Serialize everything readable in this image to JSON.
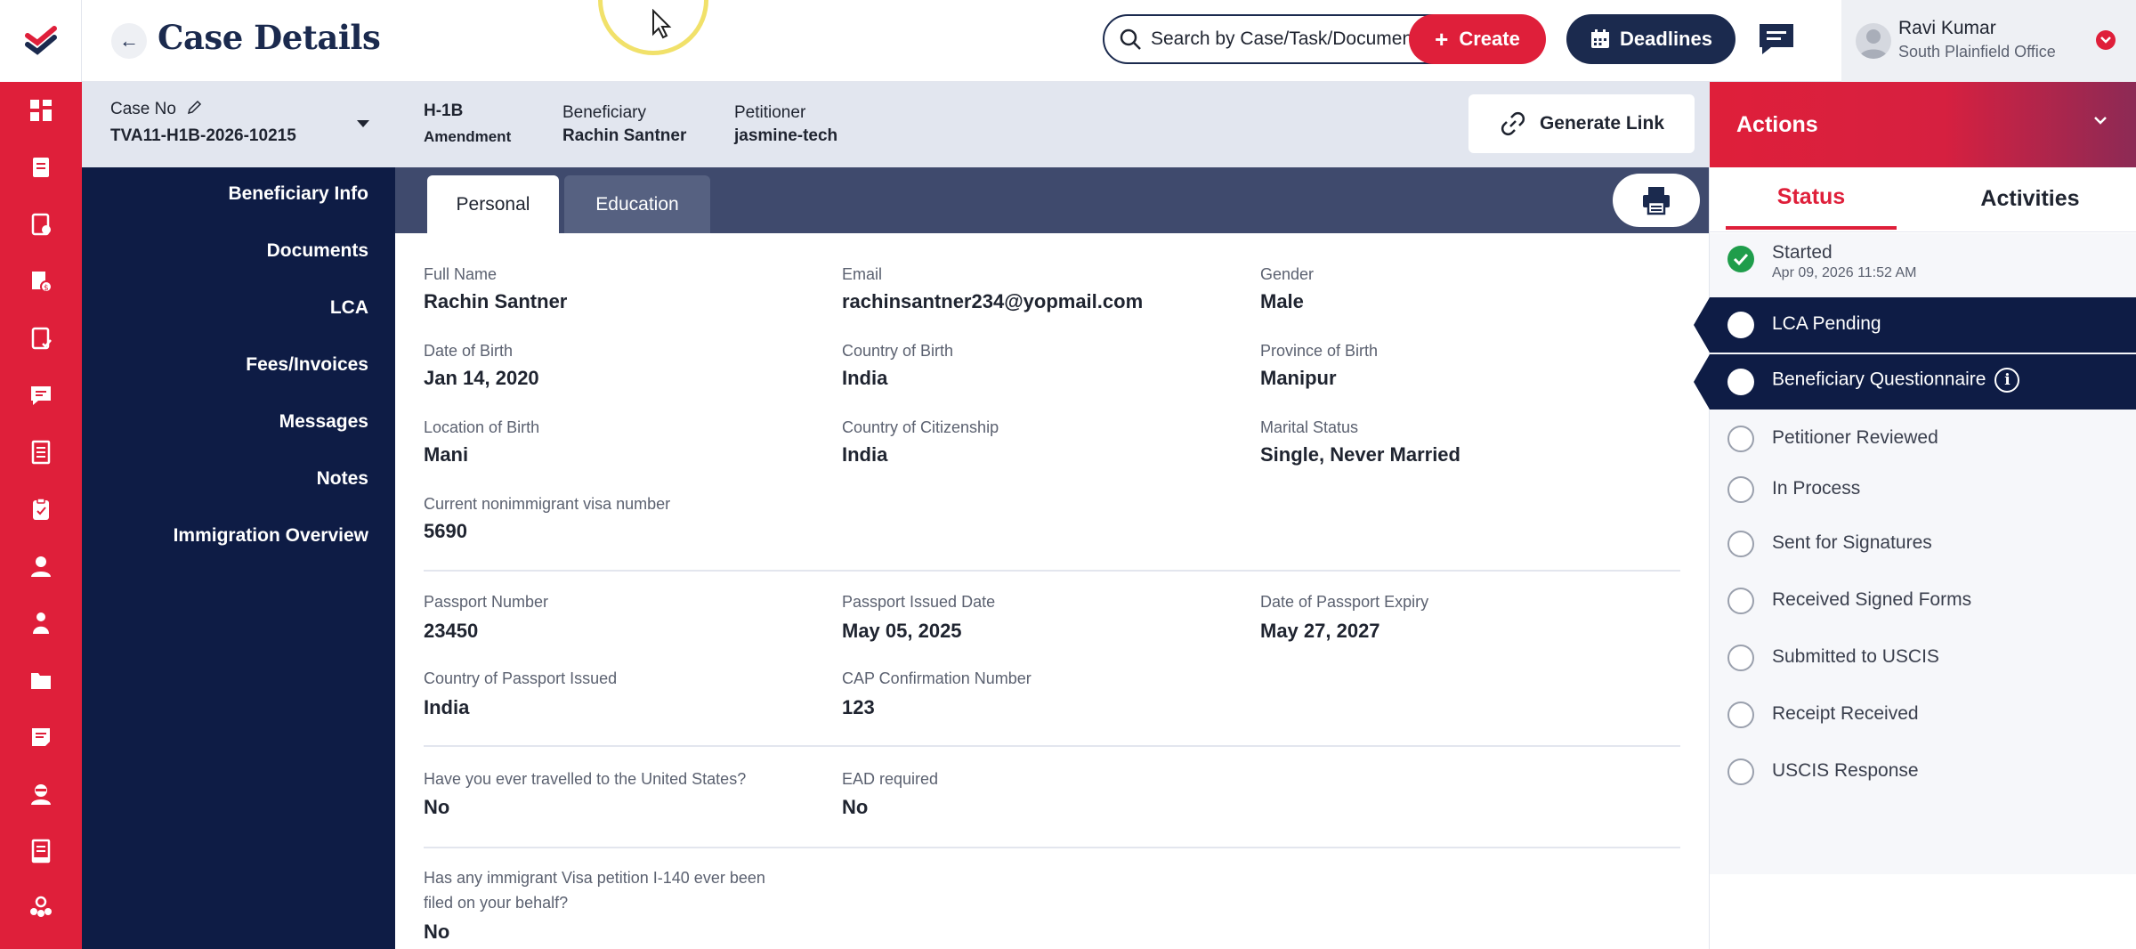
{
  "header": {
    "title": "Case Details",
    "search_placeholder": "Search by Case/Task/Document",
    "create_label": "Create",
    "deadlines_label": "Deadlines",
    "user_name": "Ravi Kumar",
    "user_office": "South Plainfield Office"
  },
  "case": {
    "case_no_label": "Case No",
    "case_no": "TVA11-H1B-2026-10215",
    "visa_type": "H-1B",
    "visa_subtype": "Amendment",
    "beneficiary_label": "Beneficiary",
    "beneficiary": "Rachin Santner",
    "petitioner_label": "Petitioner",
    "petitioner": "jasmine-tech",
    "generate_link_label": "Generate Link"
  },
  "nav": {
    "items": [
      "Beneficiary Info",
      "Documents",
      "LCA",
      "Fees/Invoices",
      "Messages",
      "Notes",
      "Immigration Overview"
    ]
  },
  "tabs": {
    "personal": "Personal",
    "education": "Education"
  },
  "personal": {
    "full_name_label": "Full Name",
    "full_name": "Rachin Santner",
    "email_label": "Email",
    "email": "rachinsantner234@yopmail.com",
    "gender_label": "Gender",
    "gender": "Male",
    "dob_label": "Date of Birth",
    "dob": "Jan 14, 2020",
    "cob_label": "Country of Birth",
    "cob": "India",
    "pob_label": "Province of Birth",
    "pob": "Manipur",
    "lob_label": "Location of Birth",
    "lob": "Mani",
    "citizenship_label": "Country of Citizenship",
    "citizenship": "India",
    "marital_label": "Marital Status",
    "marital": "Single, Never Married",
    "visa_no_label": "Current nonimmigrant visa number",
    "visa_no": "5690",
    "passport_no_label": "Passport Number",
    "passport_no": "23450",
    "passport_issued_label": "Passport Issued Date",
    "passport_issued": "May 05, 2025",
    "passport_expiry_label": "Date of Passport Expiry",
    "passport_expiry": "May 27, 2027",
    "passport_country_label": "Country of Passport Issued",
    "passport_country": "India",
    "cap_label": "CAP Confirmation Number",
    "cap": "123",
    "travelled_label": "Have you ever travelled to the United States?",
    "travelled": "No",
    "ead_label": "EAD required",
    "ead": "No",
    "i140_label_1": "Has any immigrant Visa petition I-140 ever been",
    "i140_label_2": "filed on your behalf?",
    "i140": "No"
  },
  "actions": {
    "title": "Actions",
    "tab_status": "Status",
    "tab_activities": "Activities",
    "statuses": [
      {
        "label": "Started",
        "sub": "Apr 09, 2026 11:52 AM",
        "state": "done"
      },
      {
        "label": "LCA Pending",
        "state": "current"
      },
      {
        "label": "Beneficiary Questionnaire",
        "state": "current"
      },
      {
        "label": "Petitioner Reviewed",
        "state": "pending"
      },
      {
        "label": "In Process",
        "state": "pending"
      },
      {
        "label": "Sent for Signatures",
        "state": "pending"
      },
      {
        "label": "Received Signed Forms",
        "state": "pending"
      },
      {
        "label": "Submitted to USCIS",
        "state": "pending"
      },
      {
        "label": "Receipt Received",
        "state": "pending"
      },
      {
        "label": "USCIS Response",
        "state": "pending"
      }
    ]
  },
  "colors": {
    "brand_red": "#df1f3a",
    "navy": "#0e1c45",
    "success": "#1f9d4b"
  },
  "icons": [
    "logo-icon",
    "dashboard-icon",
    "cases-icon",
    "tasks-icon",
    "invoices-icon",
    "forms-icon",
    "messages-icon",
    "documents-icon",
    "clipboard-icon",
    "user-icon",
    "users-icon",
    "folder-icon",
    "notes-icon",
    "contacts-icon",
    "reports-icon",
    "team-icon"
  ]
}
